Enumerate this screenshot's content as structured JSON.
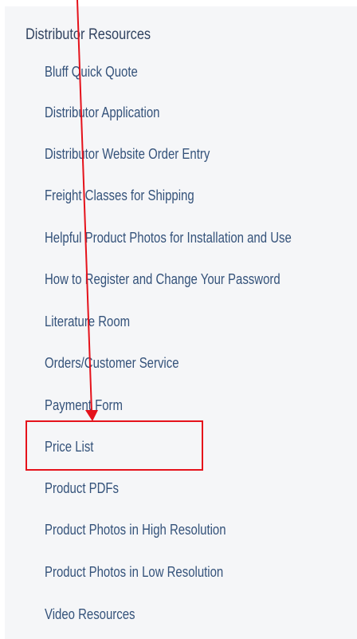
{
  "section": {
    "title": "Distributor Resources"
  },
  "menu": {
    "items": [
      {
        "label": "Bluff Quick Quote"
      },
      {
        "label": "Distributor Application"
      },
      {
        "label": "Distributor Website Order Entry"
      },
      {
        "label": "Freight Classes for Shipping"
      },
      {
        "label": "Helpful Product Photos for Installation and Use"
      },
      {
        "label": "How to Register and Change Your Password"
      },
      {
        "label": "Literature Room"
      },
      {
        "label": "Orders/Customer Service"
      },
      {
        "label": "Payment Form"
      },
      {
        "label": "Price List"
      },
      {
        "label": "Product PDFs"
      },
      {
        "label": "Product Photos in High Resolution"
      },
      {
        "label": "Product Photos in Low Resolution"
      },
      {
        "label": "Video Resources"
      }
    ]
  },
  "annotation": {
    "highlighted_item": "Price List",
    "color": "#e5121b"
  }
}
